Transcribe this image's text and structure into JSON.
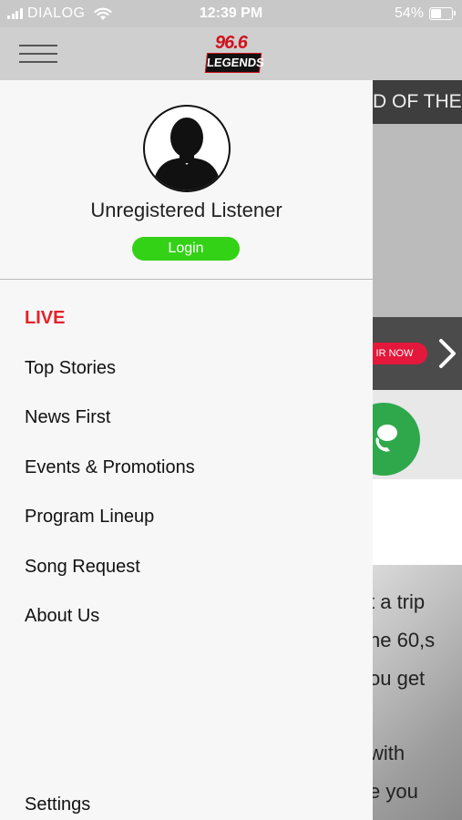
{
  "status_bar": {
    "carrier": "DIALOG",
    "time": "12:39 PM",
    "battery": "54%",
    "battery_level": 0.54
  },
  "header": {
    "logo_top": "96.6",
    "logo_bottom": "LEGENDS"
  },
  "drawer": {
    "user_name": "Unregistered Listener",
    "login_label": "Login",
    "items": [
      {
        "label": "LIVE",
        "active": true
      },
      {
        "label": "Top Stories"
      },
      {
        "label": "News First"
      },
      {
        "label": "Events & Promotions"
      },
      {
        "label": "Program Lineup"
      },
      {
        "label": "Song Request"
      },
      {
        "label": "About Us"
      }
    ],
    "settings_label": "Settings"
  },
  "background": {
    "banner_text": "D OF THE",
    "promo_button": "IR NOW",
    "text_lines": [
      "t a trip",
      "he 60,s",
      "ou get",
      "with",
      "e you"
    ]
  },
  "colors": {
    "live": "#e3222b",
    "login": "#33d217",
    "call": "#2fa84b",
    "promo_pill": "#e3183a"
  }
}
